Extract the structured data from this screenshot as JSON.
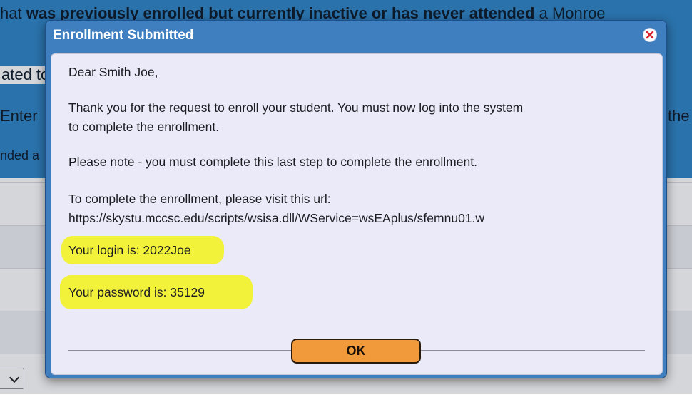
{
  "background": {
    "line1_pre": "hat ",
    "line1_bold": "was previously enrolled but currently inactive or has never attended",
    "line1_post": " a Monroe",
    "line2": "ated to",
    "line3_left": "Enter",
    "line3_right": "the",
    "line4": "nded a"
  },
  "dialog": {
    "title": "Enrollment Submitted",
    "close_icon": "close-icon",
    "greeting": "Dear Smith Joe,",
    "message_line1": "Thank you for the request to enroll your student. You must now log into the system",
    "message_line2": "to complete the enrollment.",
    "note": "Please note - you must complete this last step to complete the enrollment.",
    "url_intro": "To complete the enrollment, please visit this url:",
    "url": "https://skystu.mccsc.edu/scripts/wsisa.dll/WService=wsEAplus/sfemnu01.w",
    "login_text": "Your login is: 2022Joe",
    "password_text": "Your password is: 35129",
    "ok_label": "OK"
  },
  "colors": {
    "title_bar": "#3f7fc0",
    "body_bg": "#ebeaf8",
    "highlight": "#f2f23a",
    "ok_button": "#f09a3c"
  }
}
